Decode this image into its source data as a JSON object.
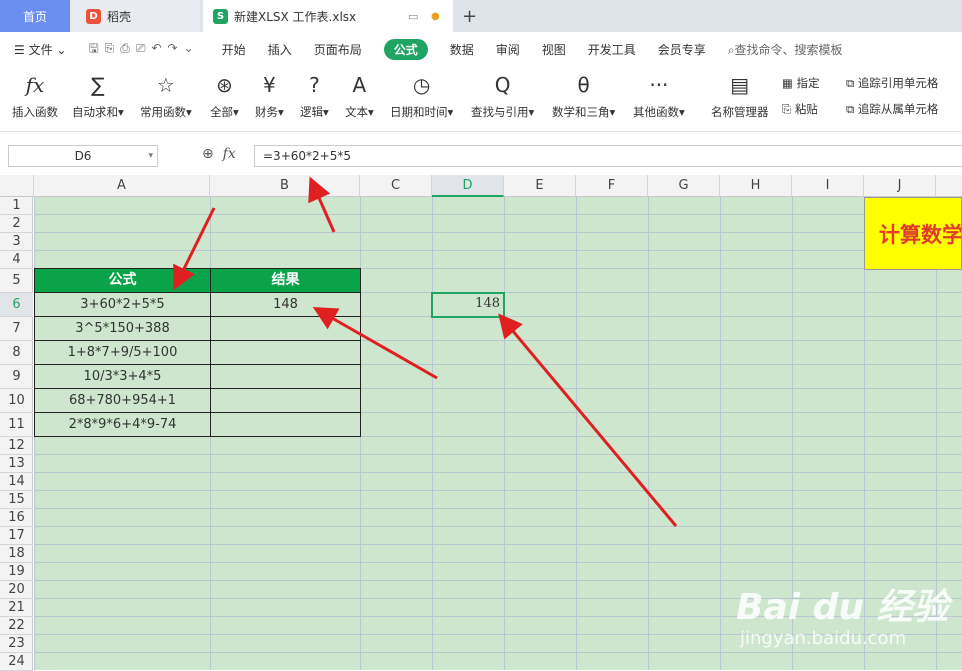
{
  "tabs": {
    "home": "首页",
    "daoke": "稻壳",
    "file": "新建XLSX 工作表.xlsx",
    "add": "+"
  },
  "menu": {
    "file": "文件",
    "items": [
      "开始",
      "插入",
      "页面布局",
      "公式",
      "数据",
      "审阅",
      "视图",
      "开发工具",
      "会员专享"
    ],
    "active": "公式",
    "search": "查找命令、搜索模板"
  },
  "ribbon": {
    "buttons": [
      {
        "icon": "fx",
        "label": "插入函数"
      },
      {
        "icon": "∑",
        "label": "自动求和"
      },
      {
        "icon": "☆",
        "label": "常用函数"
      },
      {
        "icon": "⊛",
        "label": "全部"
      },
      {
        "icon": "¥",
        "label": "财务"
      },
      {
        "icon": "?",
        "label": "逻辑"
      },
      {
        "icon": "A",
        "label": "文本"
      },
      {
        "icon": "◷",
        "label": "日期和时间"
      },
      {
        "icon": "Q",
        "label": "查找与引用"
      },
      {
        "icon": "θ",
        "label": "数学和三角"
      },
      {
        "icon": "···",
        "label": "其他函数"
      },
      {
        "icon": "▤",
        "label": "名称管理器"
      }
    ],
    "small": {
      "assign": "指定",
      "paste": "粘贴",
      "trace_prec": "追踪引用单元格",
      "trace_dep": "追踪从属单元格"
    }
  },
  "formula_bar": {
    "name_box": "D6",
    "fx": "fx",
    "formula": "=3+60*2+5*5"
  },
  "columns": [
    "A",
    "B",
    "C",
    "D",
    "E",
    "F",
    "G",
    "H",
    "I",
    "J"
  ],
  "rows": [
    "1",
    "2",
    "3",
    "4",
    "5",
    "6",
    "7",
    "8",
    "9",
    "10",
    "11",
    "12",
    "13",
    "14",
    "15",
    "16",
    "17",
    "18",
    "19",
    "20",
    "21",
    "22",
    "23",
    "24"
  ],
  "table": {
    "headers": [
      "公式",
      "结果"
    ],
    "rows": [
      [
        "3+60*2+5*5",
        "148"
      ],
      [
        "3^5*150+388",
        ""
      ],
      [
        "1+8*7+9/5+100",
        ""
      ],
      [
        "10/3*3+4*5",
        ""
      ],
      [
        "68+780+954+1",
        ""
      ],
      [
        "2*8*9*6+4*9-74",
        ""
      ]
    ]
  },
  "d6_value": "148",
  "banner": "计算数学",
  "watermark": {
    "brand": "Bai du 经验",
    "url": "jingyan.baidu.com"
  },
  "colors": {
    "active_tab": "#1fa463",
    "header_fill": "#0aa34a",
    "sheet_bg": "#cde6cd",
    "arrow": "#e02020",
    "banner_bg": "#ffff00"
  }
}
